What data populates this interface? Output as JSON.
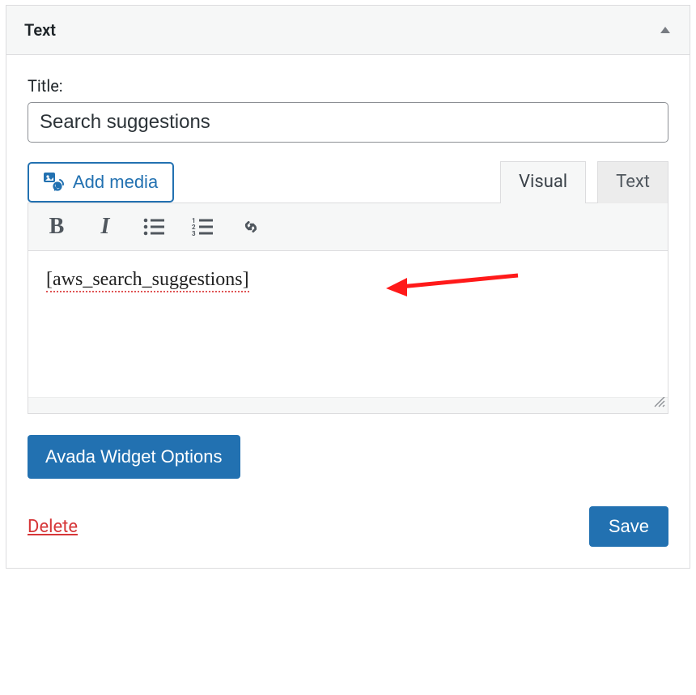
{
  "widget": {
    "header_title": "Text",
    "title_label": "Title:",
    "title_value": "Search suggestions",
    "add_media_label": "Add media",
    "tabs": {
      "visual": "Visual",
      "text": "Text"
    },
    "content_shortcode": "[aws_search_suggestions]",
    "avada_button": "Avada Widget Options",
    "delete_link": "Delete",
    "save_button": "Save"
  }
}
